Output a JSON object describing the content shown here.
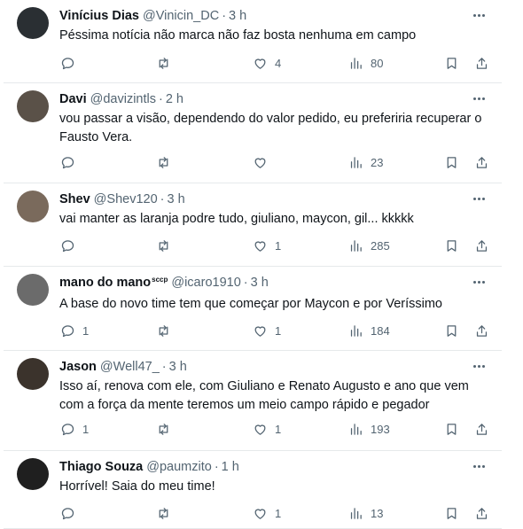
{
  "tweets": [
    {
      "name": "Vinícius Dias",
      "badge": "",
      "handle": "@Vinicin_DC",
      "separator": "·",
      "time": "3 h",
      "text": "Péssima notícia não marca não faz bosta nenhuma em campo",
      "replies": "",
      "retweets": "",
      "likes": "4",
      "views": "80",
      "avatar_color": "#2a2f33"
    },
    {
      "name": "Davi",
      "badge": "",
      "handle": "@davizintls",
      "separator": "·",
      "time": "2 h",
      "text": "vou passar a visão, dependendo do valor pedido, eu preferiria recuperar o Fausto Vera.",
      "replies": "",
      "retweets": "",
      "likes": "",
      "views": "23",
      "avatar_color": "#5a5148"
    },
    {
      "name": "Shev",
      "badge": "",
      "handle": "@Shev120",
      "separator": "·",
      "time": "3 h",
      "text": "vai manter as laranja podre tudo, giuliano, maycon, gil... kkkkk",
      "replies": "",
      "retweets": "",
      "likes": "1",
      "views": "285",
      "avatar_color": "#7a6a5c"
    },
    {
      "name": "mano do mano",
      "badge": "sccp",
      "handle": "@icaro1910",
      "separator": "·",
      "time": "3 h",
      "text": "A base do novo time tem que começar por Maycon e por Veríssimo",
      "replies": "1",
      "retweets": "",
      "likes": "1",
      "views": "184",
      "avatar_color": "#6b6b6b"
    },
    {
      "name": "Jason",
      "badge": "",
      "handle": "@Well47_",
      "separator": "·",
      "time": "3 h",
      "text": "Isso aí, renova com ele, com Giuliano e Renato Augusto e ano que vem com a força da mente teremos um meio campo rápido e pegador",
      "replies": "1",
      "retweets": "",
      "likes": "1",
      "views": "193",
      "avatar_color": "#3b332c"
    },
    {
      "name": "Thiago Souza",
      "badge": "",
      "handle": "@paumzito",
      "separator": "·",
      "time": "1 h",
      "text": "Horrível! Saia do meu time!",
      "replies": "",
      "retweets": "",
      "likes": "1",
      "views": "13",
      "avatar_color": "#1f1f1f"
    }
  ]
}
